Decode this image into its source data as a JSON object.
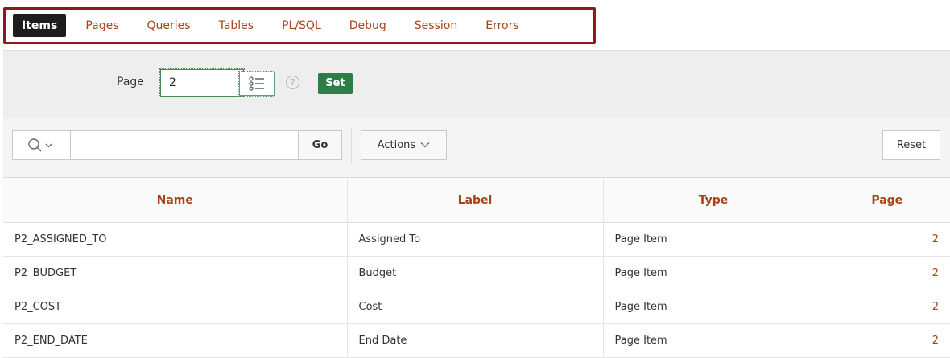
{
  "tabs": [
    {
      "label": "Items",
      "active": true
    },
    {
      "label": "Pages"
    },
    {
      "label": "Queries"
    },
    {
      "label": "Tables"
    },
    {
      "label": "PL/SQL"
    },
    {
      "label": "Debug"
    },
    {
      "label": "Session"
    },
    {
      "label": "Errors"
    }
  ],
  "page_selector": {
    "label": "Page",
    "value": "2",
    "lov_icon": "list-icon",
    "help_icon": "help-icon",
    "help_glyph": "?",
    "set_label": "Set"
  },
  "toolbar": {
    "search_icon": "search-icon",
    "search_value": "",
    "go_label": "Go",
    "actions_label": "Actions",
    "reset_label": "Reset"
  },
  "grid": {
    "columns": [
      "Name",
      "Label",
      "Type",
      "Page"
    ],
    "rows": [
      [
        "P2_ASSIGNED_TO",
        "Assigned To",
        "Page Item",
        "2"
      ],
      [
        "P2_BUDGET",
        "Budget",
        "Page Item",
        "2"
      ],
      [
        "P2_COST",
        "Cost",
        "Page Item",
        "2"
      ],
      [
        "P2_END_DATE",
        "End Date",
        "Page Item",
        "2"
      ]
    ]
  },
  "colors": {
    "accent": "#a4451a",
    "active_tab_bg": "#1d1d1d",
    "highlight_border": "#8d1a1f",
    "set_button": "#2f7d46"
  }
}
